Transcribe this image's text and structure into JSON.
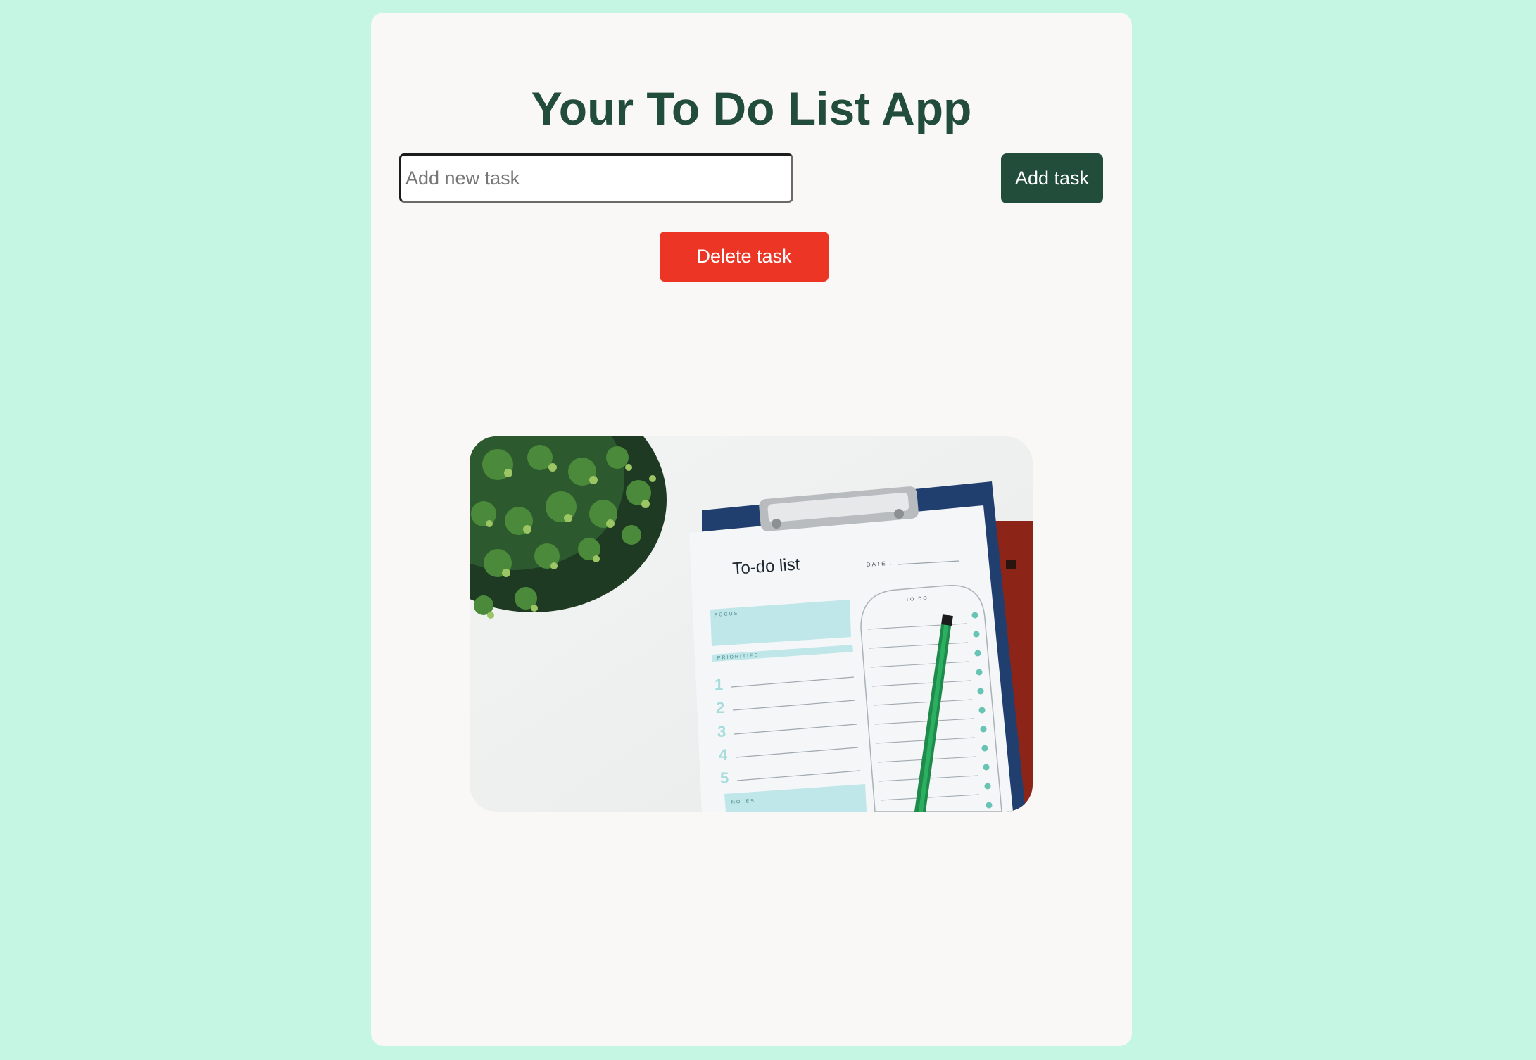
{
  "app": {
    "title": "Your To Do List App"
  },
  "task_form": {
    "input_placeholder": "Add new task",
    "input_value": "",
    "add_label": "Add task"
  },
  "actions": {
    "delete_label": "Delete task"
  },
  "hero_image": {
    "icon": "todo-clipboard-photo",
    "sheet_title": "To-do list",
    "date_label": "DATE :",
    "focus_label": "FOCUS",
    "priorities_label": "PRIORITIES",
    "todo_label": "TO DO",
    "notes_label": "NOTES",
    "priority_numbers": [
      "1",
      "2",
      "3",
      "4",
      "5"
    ]
  },
  "colors": {
    "background": "#c4f6e3",
    "card": "#faf8f6",
    "title": "#224d3a",
    "add_button": "#224d3a",
    "delete_button": "#ec3525"
  }
}
